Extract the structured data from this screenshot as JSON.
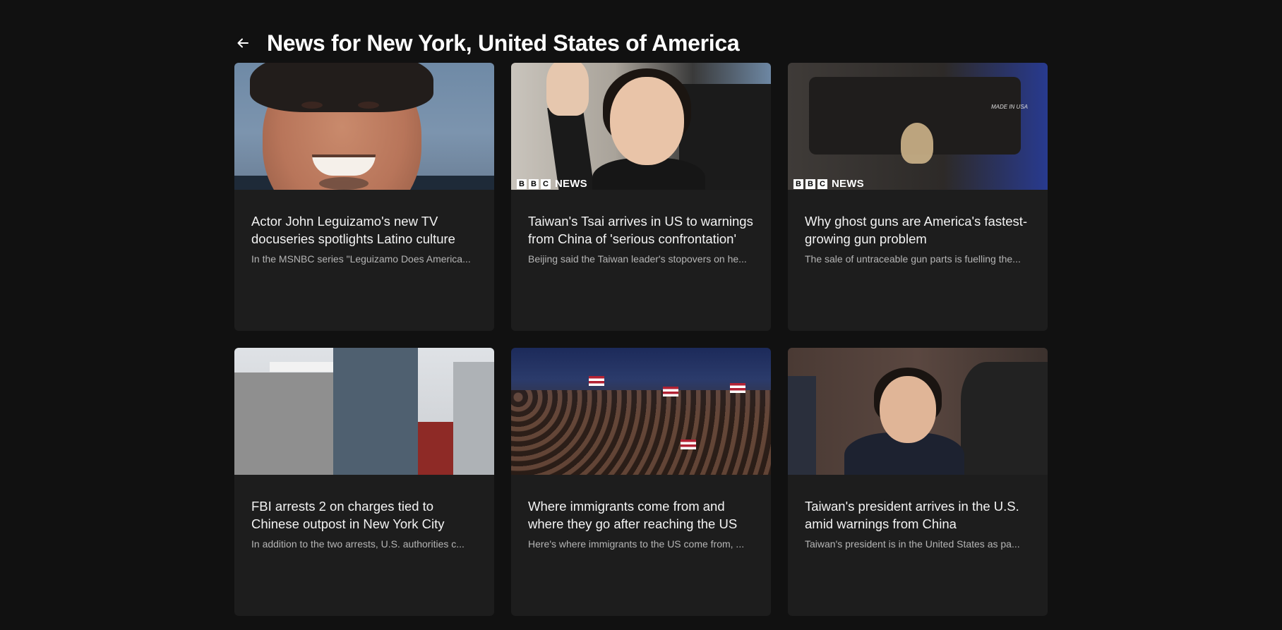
{
  "page": {
    "title": "News for New York, United States of America"
  },
  "badges": {
    "bbc_letters": [
      "B",
      "B",
      "C"
    ],
    "bbc_news": "NEWS",
    "made_in_usa": "MADE IN USA"
  },
  "articles": [
    {
      "headline": "Actor John Leguizamo's new TV docuseries spotlights Latino culture",
      "snippet": "In the MSNBC series \"Leguizamo Does America..."
    },
    {
      "headline": "Taiwan's Tsai arrives in US to warnings from China of 'serious confrontation'",
      "snippet": "Beijing said the Taiwan leader's stopovers on he..."
    },
    {
      "headline": "Why ghost guns are America's fastest-growing gun problem",
      "snippet": "The sale of untraceable gun parts is fuelling the..."
    },
    {
      "headline": "FBI arrests 2 on charges tied to Chinese outpost in New York City",
      "snippet": "In addition to the two arrests, U.S. authorities c..."
    },
    {
      "headline": "Where immigrants come from and where they go after reaching the US",
      "snippet": "Here's where immigrants to the US come from, ..."
    },
    {
      "headline": "Taiwan's president arrives in the U.S. amid warnings from China",
      "snippet": "Taiwan's president is in the United States as pa..."
    }
  ],
  "icons": {
    "back": "arrow-left-icon"
  }
}
